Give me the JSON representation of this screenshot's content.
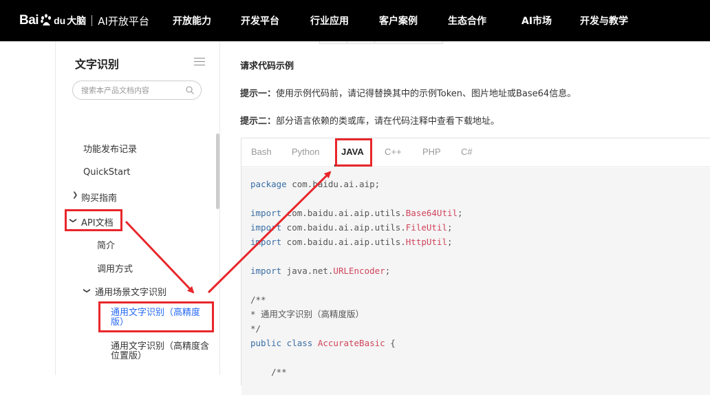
{
  "header": {
    "logo_bai": "Bai",
    "logo_du": "du",
    "logo_brain": "大脑",
    "logo_product": "AI开放平台",
    "nav": [
      "开放能力",
      "开发平台",
      "行业应用",
      "客户案例",
      "生态合作",
      "AI市场",
      "开发与教学"
    ]
  },
  "sidebar": {
    "title": "文字识别",
    "search_placeholder": "搜索本产品文档内容",
    "items": {
      "release": "功能发布记录",
      "quickstart": "QuickStart",
      "buy": "购买指南",
      "api": "API文档",
      "intro": "简介",
      "usage": "调用方式",
      "general_scene": "通用场景文字识别",
      "accurate": "通用文字识别（高精度版）",
      "accurate_loc": "通用文字识别（高精度含位置版）"
    }
  },
  "content": {
    "section_title": "请求代码示例",
    "hint1_label": "提示一：",
    "hint1_text": "使用示例代码前，请记得替换其中的示例Token、图片地址或Base64信息。",
    "hint2_label": "提示二：",
    "hint2_text": "部分语言依赖的类或库，请在代码注释中查看下载地址。",
    "tabs": [
      "Bash",
      "Python",
      "JAVA",
      "C++",
      "PHP",
      "C#"
    ],
    "active_tab": "JAVA",
    "code": {
      "l1_kw": "package",
      "l1_rest": " com.baidu.ai.aip;",
      "l3_kw": "import",
      "l3_pkg": " com.baidu.ai.aip.utils.",
      "l3_cls": "Base64Util",
      "l3_end": ";",
      "l4_kw": "import",
      "l4_pkg": " com.baidu.ai.aip.utils.",
      "l4_cls": "FileUtil",
      "l4_end": ";",
      "l5_kw": "import",
      "l5_pkg": " com.baidu.ai.aip.utils.",
      "l5_cls": "HttpUtil",
      "l5_end": ";",
      "l7_kw": "import",
      "l7_pkg": " java.net.",
      "l7_cls": "URLEncoder",
      "l7_end": ";",
      "l9": "/**",
      "l10": "* 通用文字识别（高精度版）",
      "l11": "*/",
      "l12_kw": "public class",
      "l12_cls": " AccurateBasic",
      "l12_end": " {",
      "l14": "    /**"
    }
  },
  "colors": {
    "annotation_red": "#e8262b",
    "link_blue": "#2468f2",
    "nav_bg": "#000000"
  }
}
